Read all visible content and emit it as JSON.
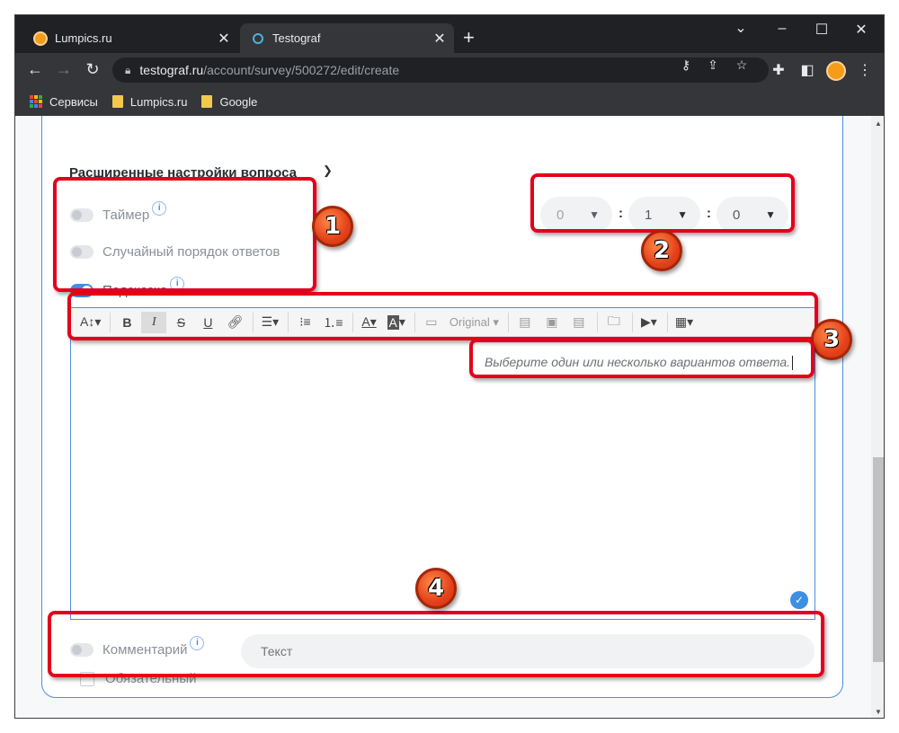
{
  "browser": {
    "tabs": [
      {
        "title": "Lumpics.ru",
        "favicon_color": "#f59c1a",
        "active": false
      },
      {
        "title": "Testograf",
        "favicon_color": "#4fb3d9",
        "active": true
      }
    ],
    "new_tab_symbol": "+",
    "window_controls": {
      "minimize": "–",
      "maximize": "☐",
      "close": "✕",
      "tab_search": "⌄"
    },
    "url_host": "testograf.ru",
    "url_path": "/account/survey/500272/edit/create",
    "bookmarks": [
      {
        "label": "Сервисы",
        "icon": "apps-grid-icon"
      },
      {
        "label": "Lumpics.ru",
        "icon": "folder-icon"
      },
      {
        "label": "Google",
        "icon": "folder-icon"
      }
    ]
  },
  "settings": {
    "title": "Расширенные настройки вопроса",
    "toggles": [
      {
        "label": "Таймер",
        "on": false,
        "info": true
      },
      {
        "label": "Случайный порядок ответов",
        "on": false,
        "info": false
      },
      {
        "label": "Подсказка",
        "on": true,
        "info": true
      }
    ],
    "timer": {
      "hours": "0",
      "minutes": "1",
      "seconds": "0",
      "separator": ":"
    }
  },
  "editor": {
    "toolbar_format_label": "Original",
    "placeholder": "Выберите один или несколько вариантов ответа."
  },
  "comment": {
    "toggle_label": "Комментарий",
    "input_placeholder": "Текст",
    "required_label": "Обязательный"
  },
  "annotations": [
    "1",
    "2",
    "3",
    "4"
  ],
  "colors": {
    "accent": "#3d8fe3",
    "annotation_red": "#e4001b",
    "annotation_badge": "#e4411a"
  }
}
